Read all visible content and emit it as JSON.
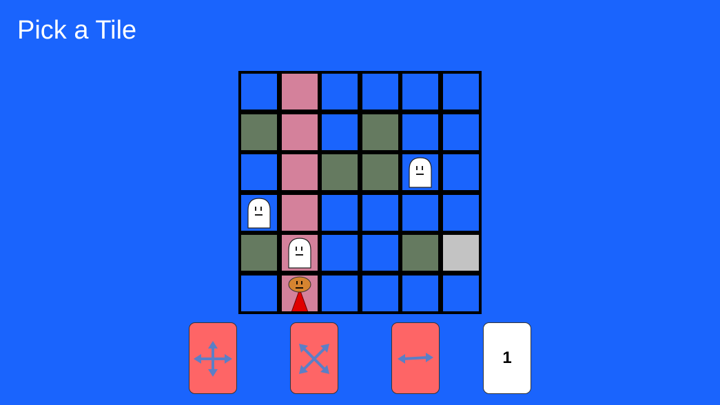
{
  "title": "Pick a Tile",
  "colors": {
    "background": "#1a64fd",
    "grid_line": "#000000",
    "tile_empty": "#1a64fd",
    "tile_path": "#d4819b",
    "tile_blocked": "#657a60",
    "tile_goal": "#c3c3c3",
    "card": "#fe6566",
    "card_number": "#ffffff",
    "arrow": "#5b7fc6"
  },
  "board": {
    "rows": 6,
    "cols": 6,
    "tiles": [
      [
        "empty",
        "path",
        "empty",
        "empty",
        "empty",
        "empty"
      ],
      [
        "blocked",
        "path",
        "empty",
        "blocked",
        "empty",
        "empty"
      ],
      [
        "empty",
        "path",
        "blocked",
        "blocked",
        "empty",
        "empty"
      ],
      [
        "empty",
        "path",
        "empty",
        "empty",
        "empty",
        "empty"
      ],
      [
        "blocked",
        "path",
        "empty",
        "empty",
        "blocked",
        "goal"
      ],
      [
        "empty",
        "path",
        "empty",
        "empty",
        "empty",
        "empty"
      ]
    ],
    "ghosts": [
      {
        "row": 2,
        "col": 4
      },
      {
        "row": 3,
        "col": 0
      },
      {
        "row": 4,
        "col": 1
      }
    ],
    "player": {
      "row": 5,
      "col": 1
    }
  },
  "cards": [
    {
      "kind": "move",
      "icon": "four-way-arrow-icon"
    },
    {
      "kind": "move",
      "icon": "diagonal-arrow-icon"
    },
    {
      "kind": "move",
      "icon": "horizontal-arrow-icon"
    },
    {
      "kind": "number",
      "value": "1"
    }
  ]
}
